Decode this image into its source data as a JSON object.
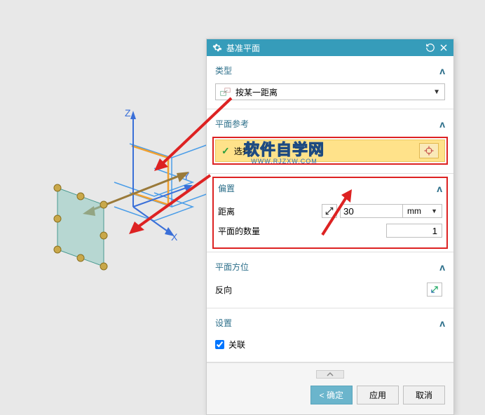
{
  "panel": {
    "title": "基准平面"
  },
  "sections": {
    "type": {
      "title": "类型",
      "dropdown_label": "按某一距离"
    },
    "ref": {
      "title": "平面参考",
      "select_label": "选择"
    },
    "offset": {
      "title": "偏置",
      "distance_label": "距离",
      "distance_value": "30",
      "distance_unit": "mm",
      "count_label": "平面的数量",
      "count_value": "1"
    },
    "orient": {
      "title": "平面方位",
      "reverse_label": "反向"
    },
    "settings": {
      "title": "设置",
      "assoc_label": "关联"
    }
  },
  "buttons": {
    "ok": "确定",
    "apply": "应用",
    "cancel": "取消"
  },
  "axes": {
    "x": "X",
    "y": "Y",
    "z": "Z"
  },
  "watermark": {
    "main": "软件自学网",
    "sub": "WWW.RJZXW.COM"
  }
}
